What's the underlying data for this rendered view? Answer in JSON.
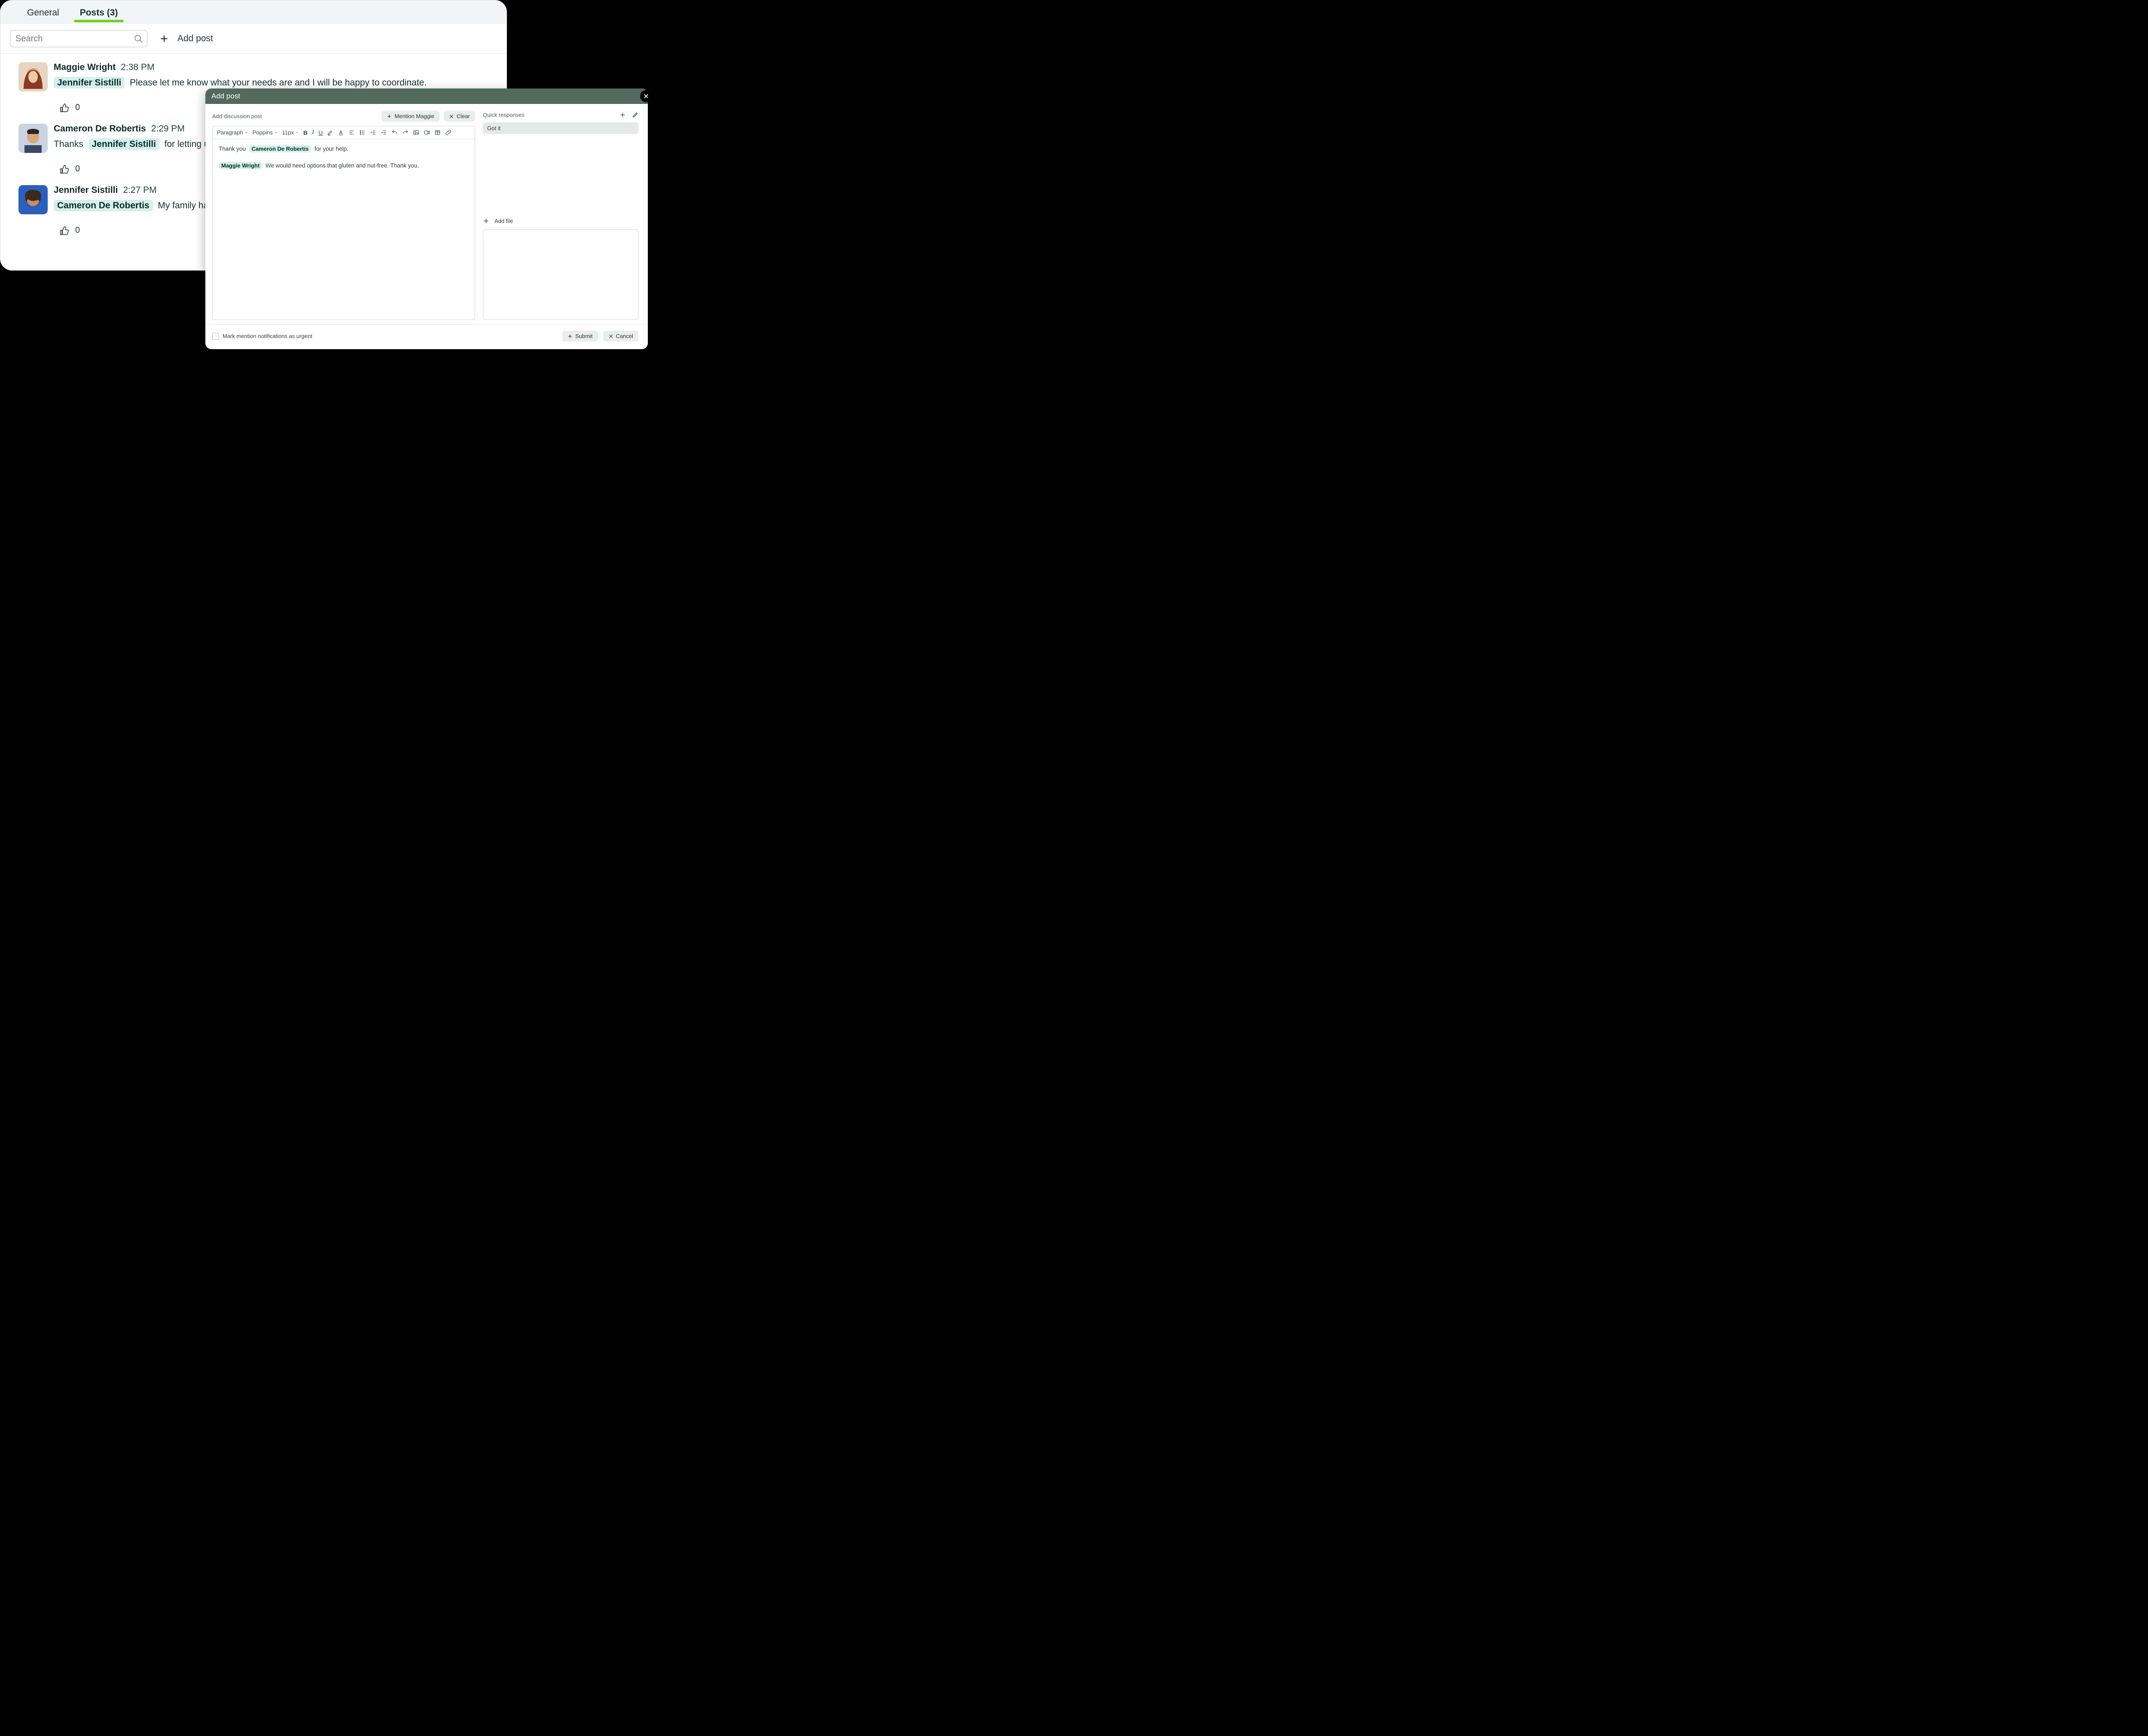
{
  "tabs": {
    "general": "General",
    "posts": "Posts (3)"
  },
  "search": {
    "placeholder": "Search"
  },
  "addPost": {
    "label": "Add post"
  },
  "posts": [
    {
      "author": "Maggie Wright",
      "time": "2:38 PM",
      "mention": "Jennifer Sistilli",
      "text": "Please let me know what your needs are and I will be happy to coordinate.",
      "likes": "0"
    },
    {
      "author": "Cameron De Robertis",
      "time": "2:29 PM",
      "pre": "Thanks",
      "mention": "Jennifer Sistilli",
      "text": "for letting us k",
      "likes": "0"
    },
    {
      "author": "Jennifer Sistilli",
      "time": "2:27 PM",
      "mention": "Cameron De Robertis",
      "text": "My family has",
      "likes": "0"
    }
  ],
  "modal": {
    "title": "Add post",
    "editorTitle": "Add discussion post",
    "mentionBtn": "Mention Maggie",
    "clearBtn": "Clear",
    "format": {
      "style": "Paragraph",
      "font": "Poppins",
      "size": "11px"
    },
    "content": {
      "line1_pre": "Thank you",
      "line1_mention": "Cameron De Robertis",
      "line1_post": "for your help.",
      "line2_mention": "Maggie Wright",
      "line2_post": "We would need options that gluten and nut-free. Thank you."
    },
    "quick": {
      "label": "Quick responses",
      "item": "Got it"
    },
    "addFile": "Add file",
    "urgent": "Mark mention notifications as urgent",
    "submit": "Submit",
    "cancel": "Cancel"
  }
}
